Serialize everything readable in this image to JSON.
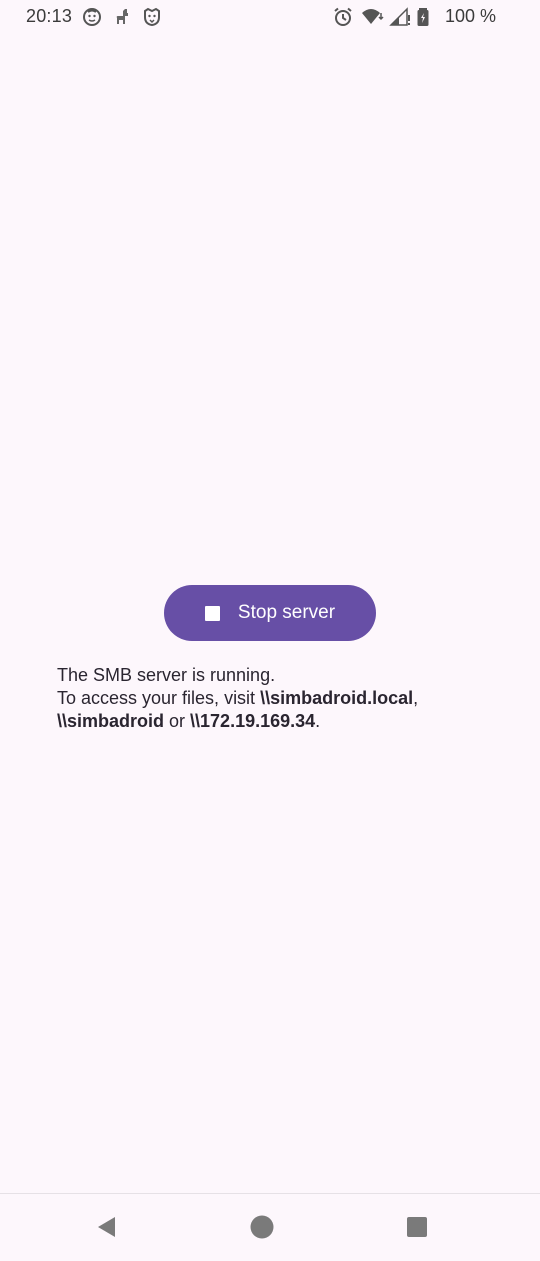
{
  "status_bar": {
    "time": "20:13",
    "notification_icons": [
      "face-icon",
      "llama-icon",
      "lion-icon"
    ],
    "system_icons": [
      "alarm-icon",
      "wifi-icon",
      "signal-icon",
      "battery-icon"
    ],
    "battery_text": "100 %"
  },
  "main": {
    "stop_button_label": "Stop server",
    "message": {
      "line1": "The SMB server is running.",
      "line2_prefix": "To access your files, visit ",
      "address1": "\\\\simbadroid.local",
      "sep1": ",",
      "address2": "\\\\simbadroid",
      "sep2": " or ",
      "address3": "\\\\172.19.169.34",
      "end": "."
    }
  },
  "nav_bar": {
    "icons": [
      "back-icon",
      "home-icon",
      "recents-icon"
    ]
  },
  "colors": {
    "background": "#fdf7fc",
    "accent": "#674fa6",
    "text": "#2a2530"
  }
}
